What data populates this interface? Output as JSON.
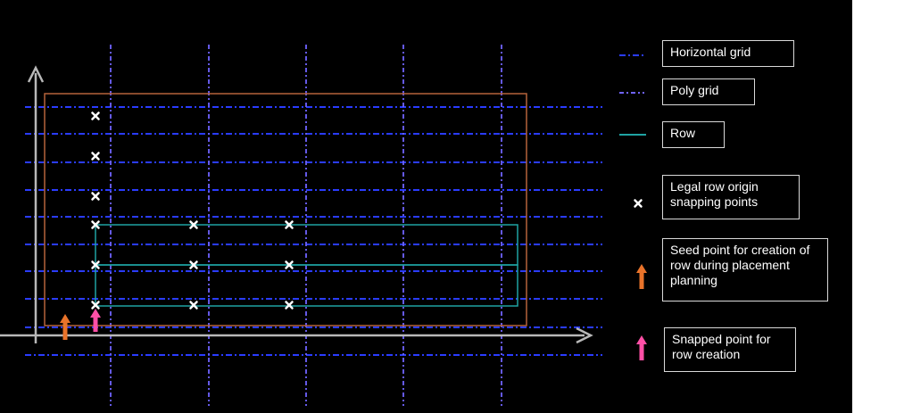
{
  "colors": {
    "background": "#000000",
    "horizontal_grid": "#2a3cff",
    "poly_grid": "#6f63ff",
    "row": "#1fa3a3",
    "boundary": "#b5633a",
    "axis": "#b8b8b8",
    "snap_point": "#ffffff",
    "seed_arrow": "#e9732a",
    "snapped_arrow": "#ff4fa6"
  },
  "legend": {
    "horizontal_grid": "Horizontal grid",
    "poly_grid": "Poly grid",
    "row": "Row",
    "snapping_points": "Legal row origin snapping points",
    "seed_point": "Seed point for creation of row during placement planning",
    "snapped_point": "Snapped point for row creation"
  },
  "icons": {
    "snap_point": "cross-mark-icon",
    "seed_arrow": "up-arrow-icon",
    "snapped_arrow": "up-arrow-icon"
  }
}
